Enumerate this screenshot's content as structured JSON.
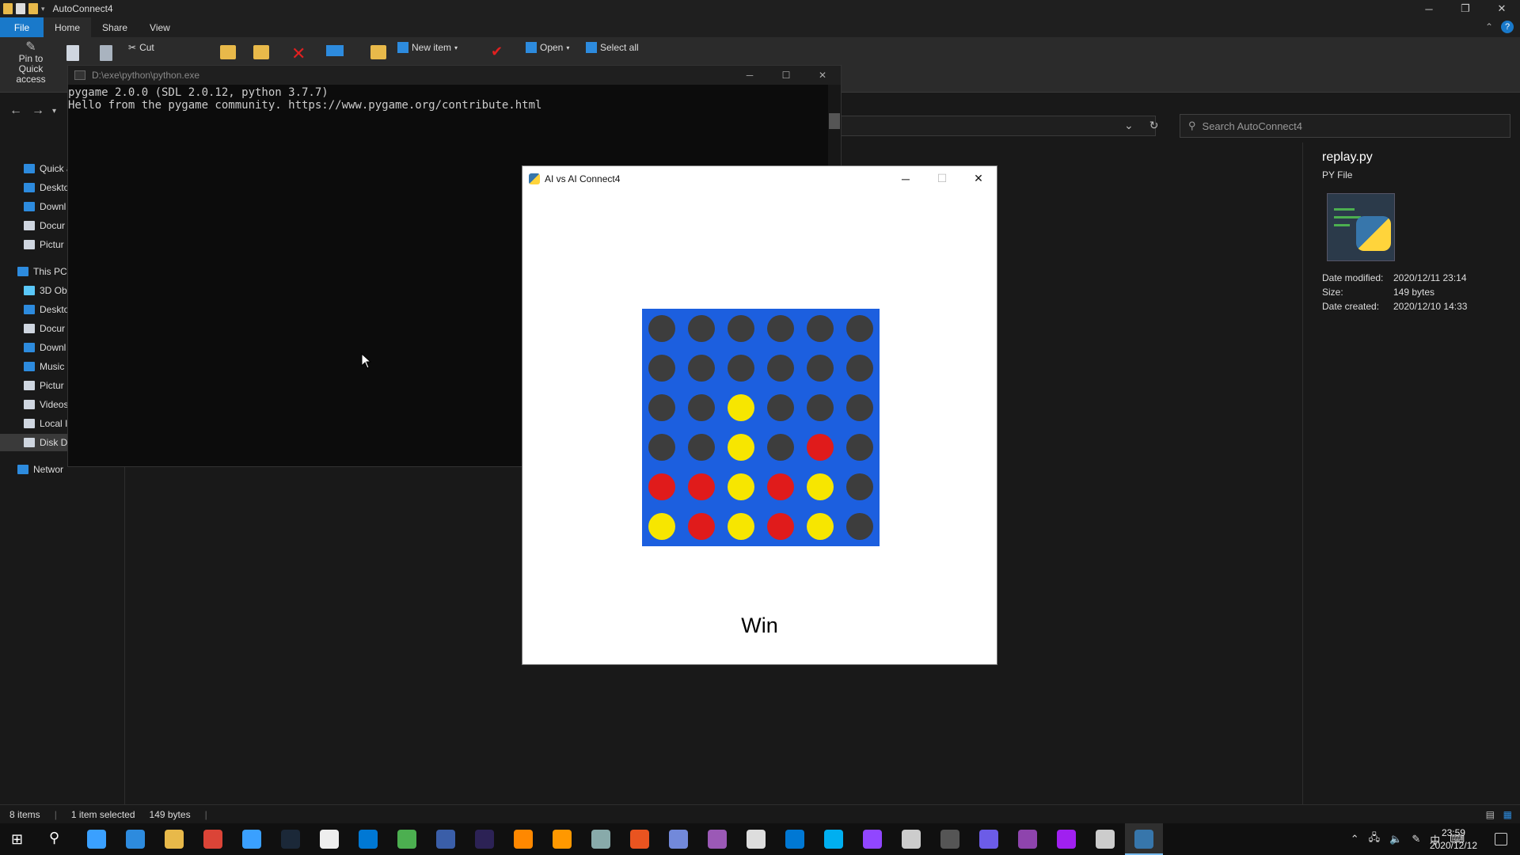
{
  "explorer": {
    "title": "AutoConnect4",
    "tabs": [
      "File",
      "Home",
      "Share",
      "View"
    ],
    "ribbon": {
      "pin_label": "Pin to Quick access",
      "cut_label": "Cut",
      "new_item_label": "New item",
      "open_label": "Open",
      "select_all_label": "Select all"
    },
    "search_placeholder": "Search AutoConnect4",
    "nav_items": [
      {
        "label": "Quick a",
        "icon": "star-icon",
        "color": "#2d8bde"
      },
      {
        "label": "Deskto",
        "icon": "desktop-icon",
        "color": "#2d8bde"
      },
      {
        "label": "Downl",
        "icon": "download-icon",
        "color": "#2d8bde"
      },
      {
        "label": "Docur",
        "icon": "document-icon",
        "color": "#cfd6e0"
      },
      {
        "label": "Pictur",
        "icon": "picture-icon",
        "color": "#cfd6e0"
      },
      {
        "label": "This PC",
        "icon": "pc-icon",
        "color": "#2d8bde"
      },
      {
        "label": "3D Ob",
        "icon": "cube-icon",
        "color": "#5ac8fa"
      },
      {
        "label": "Deskto",
        "icon": "desktop-icon",
        "color": "#2d8bde"
      },
      {
        "label": "Docur",
        "icon": "document-icon",
        "color": "#cfd6e0"
      },
      {
        "label": "Downl",
        "icon": "download-icon",
        "color": "#2d8bde"
      },
      {
        "label": "Music",
        "icon": "music-icon",
        "color": "#2d8bde"
      },
      {
        "label": "Pictur",
        "icon": "picture-icon",
        "color": "#cfd6e0"
      },
      {
        "label": "Videos",
        "icon": "video-icon",
        "color": "#cfd6e0"
      },
      {
        "label": "Local I",
        "icon": "drive-icon",
        "color": "#cfd6e0"
      },
      {
        "label": "Disk D",
        "icon": "drive-icon",
        "color": "#cfd6e0"
      },
      {
        "label": "Networ",
        "icon": "network-icon",
        "color": "#2d8bde"
      }
    ],
    "details": {
      "name": "replay.py",
      "type": "PY File",
      "rows": [
        {
          "key": "Date modified:",
          "value": "2020/12/11 23:14"
        },
        {
          "key": "Size:",
          "value": "149 bytes"
        },
        {
          "key": "Date created:",
          "value": "2020/12/10 14:33"
        }
      ]
    },
    "status": {
      "items": "8 items",
      "selected": "1 item selected",
      "size": "149 bytes"
    }
  },
  "console": {
    "title": "D:\\exe\\python\\python.exe",
    "lines": [
      "pygame 2.0.0 (SDL 2.0.12, python 3.7.7)",
      "Hello from the pygame community. https://www.pygame.org/contribute.html"
    ]
  },
  "game": {
    "title": "AI vs AI Connect4",
    "status": "Win",
    "colors": {
      "board": "#1c5fdf",
      "empty": "#3d3d3d",
      "red": "#e01b1b",
      "yellow": "#f7e600"
    },
    "grid": [
      [
        "E",
        "E",
        "E",
        "E",
        "E",
        "E"
      ],
      [
        "E",
        "E",
        "E",
        "E",
        "E",
        "E"
      ],
      [
        "E",
        "E",
        "Y",
        "E",
        "E",
        "E"
      ],
      [
        "E",
        "E",
        "Y",
        "E",
        "R",
        "E"
      ],
      [
        "R",
        "R",
        "Y",
        "R",
        "Y",
        "E"
      ],
      [
        "Y",
        "R",
        "Y",
        "R",
        "Y",
        "E"
      ]
    ]
  },
  "taskbar": {
    "clock_time": "23:59",
    "clock_date": "2020/12/12",
    "ime_label": "中"
  }
}
